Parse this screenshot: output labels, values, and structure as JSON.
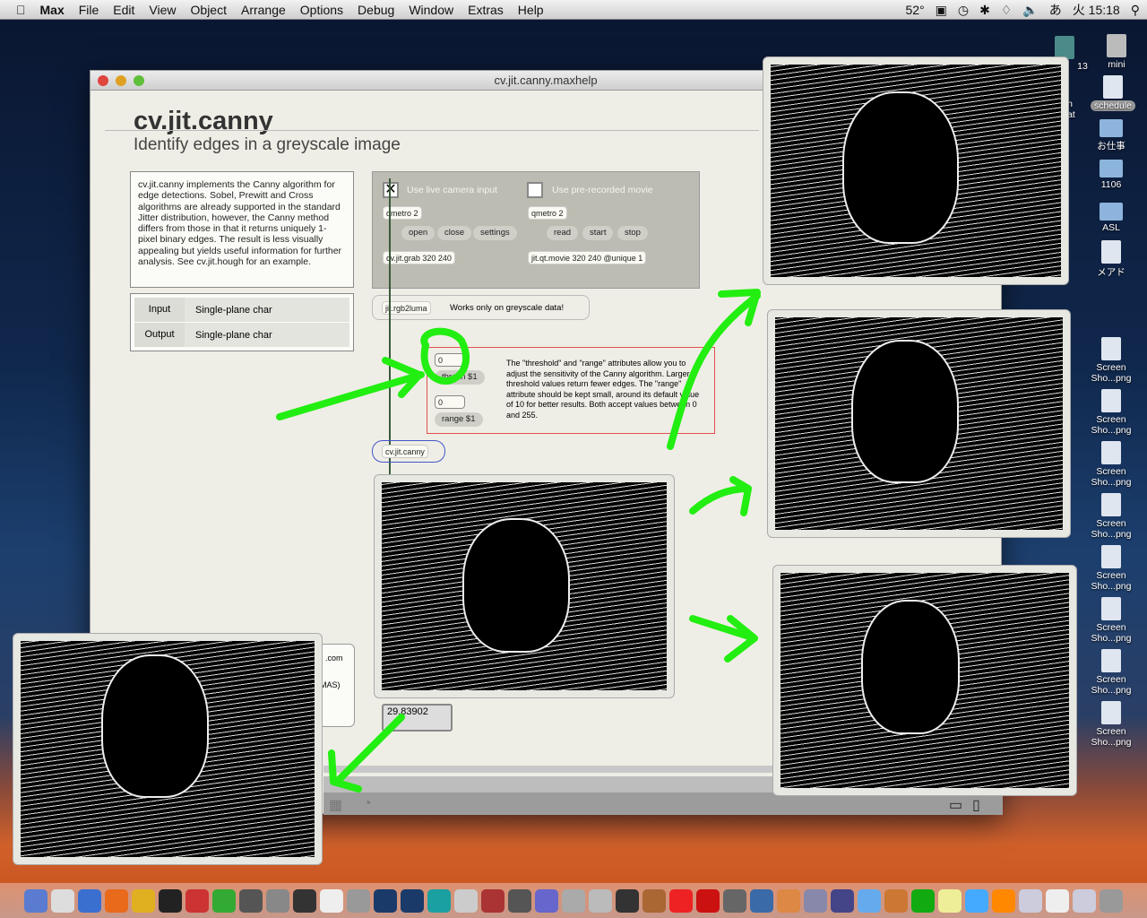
{
  "menubar": {
    "app": "Max",
    "items": [
      "File",
      "Edit",
      "View",
      "Object",
      "Arrange",
      "Options",
      "Debug",
      "Window",
      "Extras",
      "Help"
    ],
    "temp": "52°",
    "input_method": "あ",
    "clock": "火 15:18"
  },
  "window": {
    "title": "cv.jit.canny.maxhelp",
    "heading": "cv.jit.canny",
    "subtitle": "Identify edges in a greyscale image",
    "description": "cv.jit.canny implements the Canny algorithm for edge detections. Sobel, Prewitt and Cross algorithms are already supported in the standard Jitter distribution, however, the Canny method differs from those in that it returns uniquely 1-pixel binary edges. The result is less visually appealing but yields useful information for further analysis. See cv.jit.hough for an example.",
    "io": [
      {
        "k": "Input",
        "v": "Single-plane char"
      },
      {
        "k": "Output",
        "v": "Single-plane char"
      }
    ],
    "patch": {
      "live_label": "Use live camera input",
      "movie_label": "Use pre-recorded movie",
      "qmetro_left": "qmetro 2",
      "qmetro_right": "qmetro 2",
      "open": "open",
      "close": "close",
      "settings": "settings",
      "read": "read",
      "start": "start",
      "stop": "stop",
      "grab": "cv.jit.grab 320 240",
      "movie": "jit.qt.movie 320 240 @unique 1",
      "luma": "jit.rgb2luma",
      "luma_note": "Works only on greyscale data!",
      "threshold_num": "0",
      "threshold_msg": "thresh $1",
      "range_num": "0",
      "range_msg": "range $1",
      "attr_note": "The \"threshold\" and \"range\" attributes allow you to adjust the sensitivity of the Canny algorithm. Larger threshold values return fewer edges. The \"range\" attribute should be kept small, around its default value of 10 for better results. Both accept values between 0 and 255.",
      "canny": "cv.jit.canny",
      "fps": "29.83902",
      "side_a": ".com",
      "side_b": "MAS)"
    }
  },
  "desktop": {
    "icons": [
      "13",
      "mini",
      "sen xpat",
      "schedule",
      "お仕事",
      "1106",
      "ASL",
      "メアド"
    ],
    "screenshots": [
      "Screen Sho...png",
      "Screen Sho...png",
      "Screen Sho...png",
      "Screen Sho...png",
      "Screen Sho...png",
      "Screen Sho...png",
      "Screen Sho...png",
      "Screen Sho...png"
    ]
  },
  "annotation_color": "#22ee11"
}
